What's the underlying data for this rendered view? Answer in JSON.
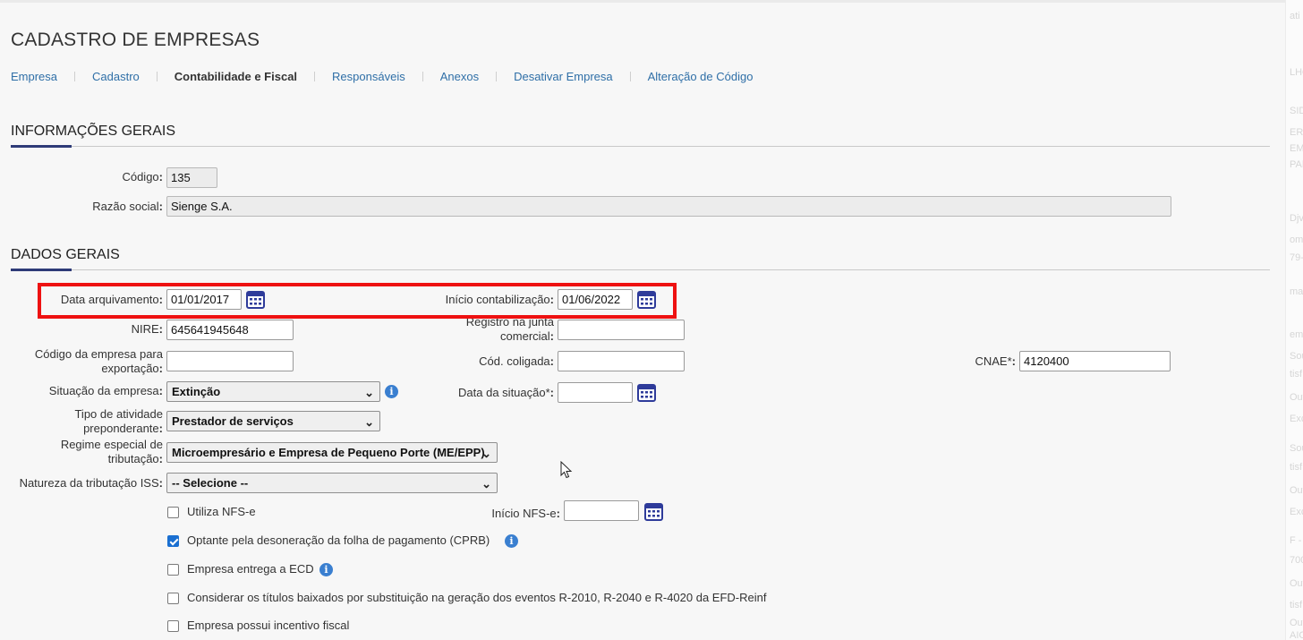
{
  "page": {
    "title": "CADASTRO DE EMPRESAS"
  },
  "tabs": [
    {
      "label": "Empresa"
    },
    {
      "label": "Cadastro"
    },
    {
      "label": "Contabilidade e Fiscal",
      "active": true
    },
    {
      "label": "Responsáveis"
    },
    {
      "label": "Anexos"
    },
    {
      "label": "Desativar Empresa"
    },
    {
      "label": "Alteração de Código"
    }
  ],
  "informacoes_gerais": {
    "title": "INFORMAÇÕES GERAIS",
    "codigo": {
      "label": "Código",
      "value": "135"
    },
    "razao_social": {
      "label": "Razão social",
      "value": "Sienge S.A."
    }
  },
  "dados_gerais": {
    "title": "DADOS GERAIS",
    "data_arquivamento": {
      "label": "Data arquivamento",
      "value": "01/01/2017"
    },
    "inicio_contabilizacao": {
      "label": "Início contabilização",
      "value": "01/06/2022"
    },
    "nire": {
      "label": "NIRE",
      "value": "645641945648"
    },
    "registro_junta": {
      "label_line1": "Registro na junta",
      "label_line2": "comercial",
      "value": ""
    },
    "codigo_exportacao": {
      "label_line1": "Código da empresa para",
      "label_line2": "exportação",
      "value": ""
    },
    "cod_coligada": {
      "label": "Cód. coligada",
      "value": ""
    },
    "cnae": {
      "label": "CNAE*",
      "value": "4120400"
    },
    "situacao": {
      "label": "Situação da empresa",
      "value": "Extinção"
    },
    "data_situacao": {
      "label": "Data da situação*",
      "value": ""
    },
    "tipo_atividade": {
      "label_line1": "Tipo de atividade",
      "label_line2": "preponderante",
      "value": "Prestador de serviços"
    },
    "regime_especial": {
      "label_line1": "Regime especial de",
      "label_line2": "tributação",
      "value": "Microempresário e Empresa de Pequeno Porte (ME/EPP)"
    },
    "natureza_iss": {
      "label": "Natureza da tributação ISS",
      "value": "-- Selecione --"
    },
    "inicio_nfse": {
      "label": "Início NFS-e",
      "value": ""
    },
    "checkboxes": [
      {
        "label": "Utiliza NFS-e",
        "checked": false
      },
      {
        "label": "Optante pela desoneração da folha de pagamento (CPRB)",
        "checked": true
      },
      {
        "label": "Empresa entrega a ECD",
        "checked": false
      },
      {
        "label": "Considerar os títulos baixados por substituição na geração dos eventos R-2010, R-2040 e R-4020 da EFD-Reinf",
        "checked": false
      },
      {
        "label": "Empresa possui incentivo fiscal",
        "checked": false
      }
    ]
  },
  "side_panel_fragments": [
    "ati",
    "LHO",
    "SID",
    "ERG",
    "EMP",
    "PAR",
    "Djv",
    "om",
    "79-",
    "ma",
    "em",
    "Sou",
    "tisf",
    "Out",
    "Exc",
    "Sou",
    "tisf",
    "Out",
    "Exc",
    "F -",
    "700",
    "Out",
    "tisf",
    "Out",
    "Exc",
    "AIC"
  ],
  "colors": {
    "accent": "#2e3b78",
    "link": "#2f6fa7",
    "highlight": "#ee1111",
    "checkbox": "#1a6fd1",
    "info": "#3a7fd0"
  }
}
